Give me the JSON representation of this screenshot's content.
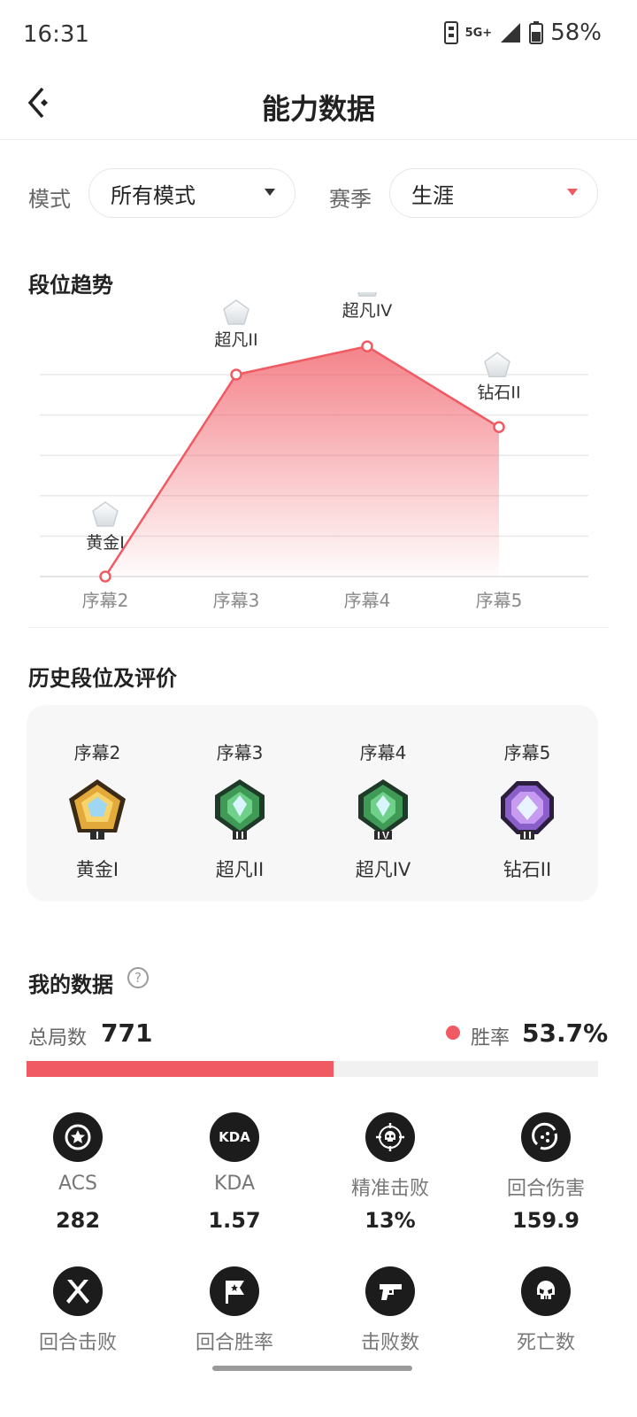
{
  "status_bar": {
    "time": "16:31",
    "network": "5G+",
    "battery": "58%"
  },
  "header": {
    "title": "能力数据"
  },
  "filters": {
    "mode_label": "模式",
    "mode_value": "所有模式",
    "season_label": "赛季",
    "season_value": "生涯"
  },
  "rank_trend": {
    "title": "段位趋势"
  },
  "chart_data": {
    "type": "area",
    "categories": [
      "序幕2",
      "序幕3",
      "序幕4",
      "序幕5"
    ],
    "point_labels": [
      "黄金I",
      "超凡II",
      "超凡IV",
      "钻石II"
    ],
    "rank_level": [
      0,
      5,
      5.7,
      3.7
    ],
    "colors": {
      "line": "#f05a63",
      "fill": "#f05a63"
    },
    "grid": true
  },
  "history": {
    "title": "历史段位及评价",
    "items": [
      {
        "season": "序幕2",
        "rank": "黄金I",
        "badge": "gold-rank-badge-icon"
      },
      {
        "season": "序幕3",
        "rank": "超凡II",
        "badge": "ascendant-rank-badge-icon"
      },
      {
        "season": "序幕4",
        "rank": "超凡IV",
        "badge": "ascendant-rank-badge-icon"
      },
      {
        "season": "序幕5",
        "rank": "钻石II",
        "badge": "diamond-rank-badge-icon"
      }
    ]
  },
  "my_data": {
    "title": "我的数据",
    "total_label": "总局数",
    "total_value": "771",
    "win_label": "胜率",
    "win_value": "53.7%",
    "win_fraction": 0.537,
    "stats": [
      {
        "label": "ACS",
        "value": "282",
        "icon": "star-badge-icon"
      },
      {
        "label": "KDA",
        "value": "1.57",
        "icon": "kda-icon",
        "icon_text": "KDA"
      },
      {
        "label": "精准击败",
        "value": "13%",
        "icon": "crosshair-skull-icon"
      },
      {
        "label": "回合伤害",
        "value": "159.9",
        "icon": "damage-icon"
      },
      {
        "label": "回合击败",
        "value": "",
        "icon": "crossed-blades-icon"
      },
      {
        "label": "回合胜率",
        "value": "",
        "icon": "star-flag-icon"
      },
      {
        "label": "击败数",
        "value": "",
        "icon": "pistol-icon"
      },
      {
        "label": "死亡数",
        "value": "",
        "icon": "skull-icon"
      }
    ]
  },
  "colors": {
    "accent": "#f05a63",
    "dark_icon": "#1c1c1c"
  }
}
